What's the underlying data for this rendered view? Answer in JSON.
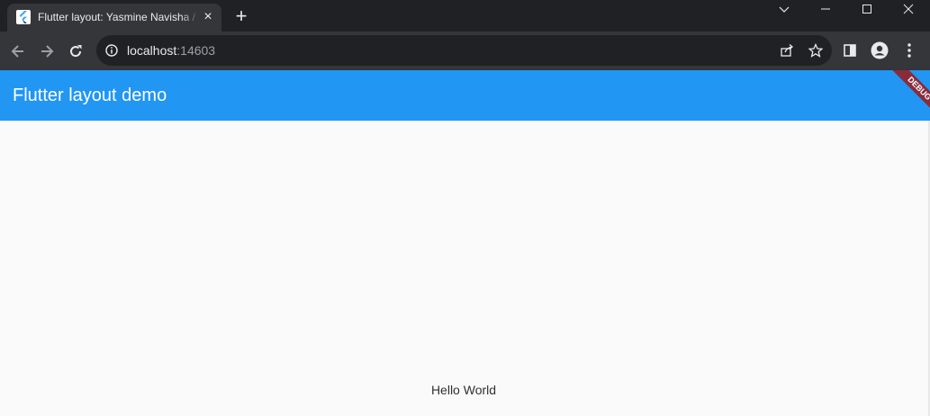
{
  "browser": {
    "tab": {
      "title": "Flutter layout: Yasmine Navisha / ...",
      "close_label": "×",
      "favicon": "flutter-icon"
    },
    "new_tab_label": "+",
    "window_controls": [
      "chevron-down-icon",
      "minimize-icon",
      "maximize-icon",
      "close-icon"
    ],
    "address": {
      "host": "localhost",
      "port": ":14603"
    },
    "colors": {
      "tabstrip": "#202124",
      "toolbar": "#35363a",
      "omnibox": "#202124"
    }
  },
  "app": {
    "title": "Flutter layout demo",
    "debug_banner": "DEBUG",
    "body_text": "Hello World",
    "colors": {
      "appbar": "#2196f3",
      "background": "#fafafa",
      "debug_banner": "#8a2b3a"
    }
  }
}
